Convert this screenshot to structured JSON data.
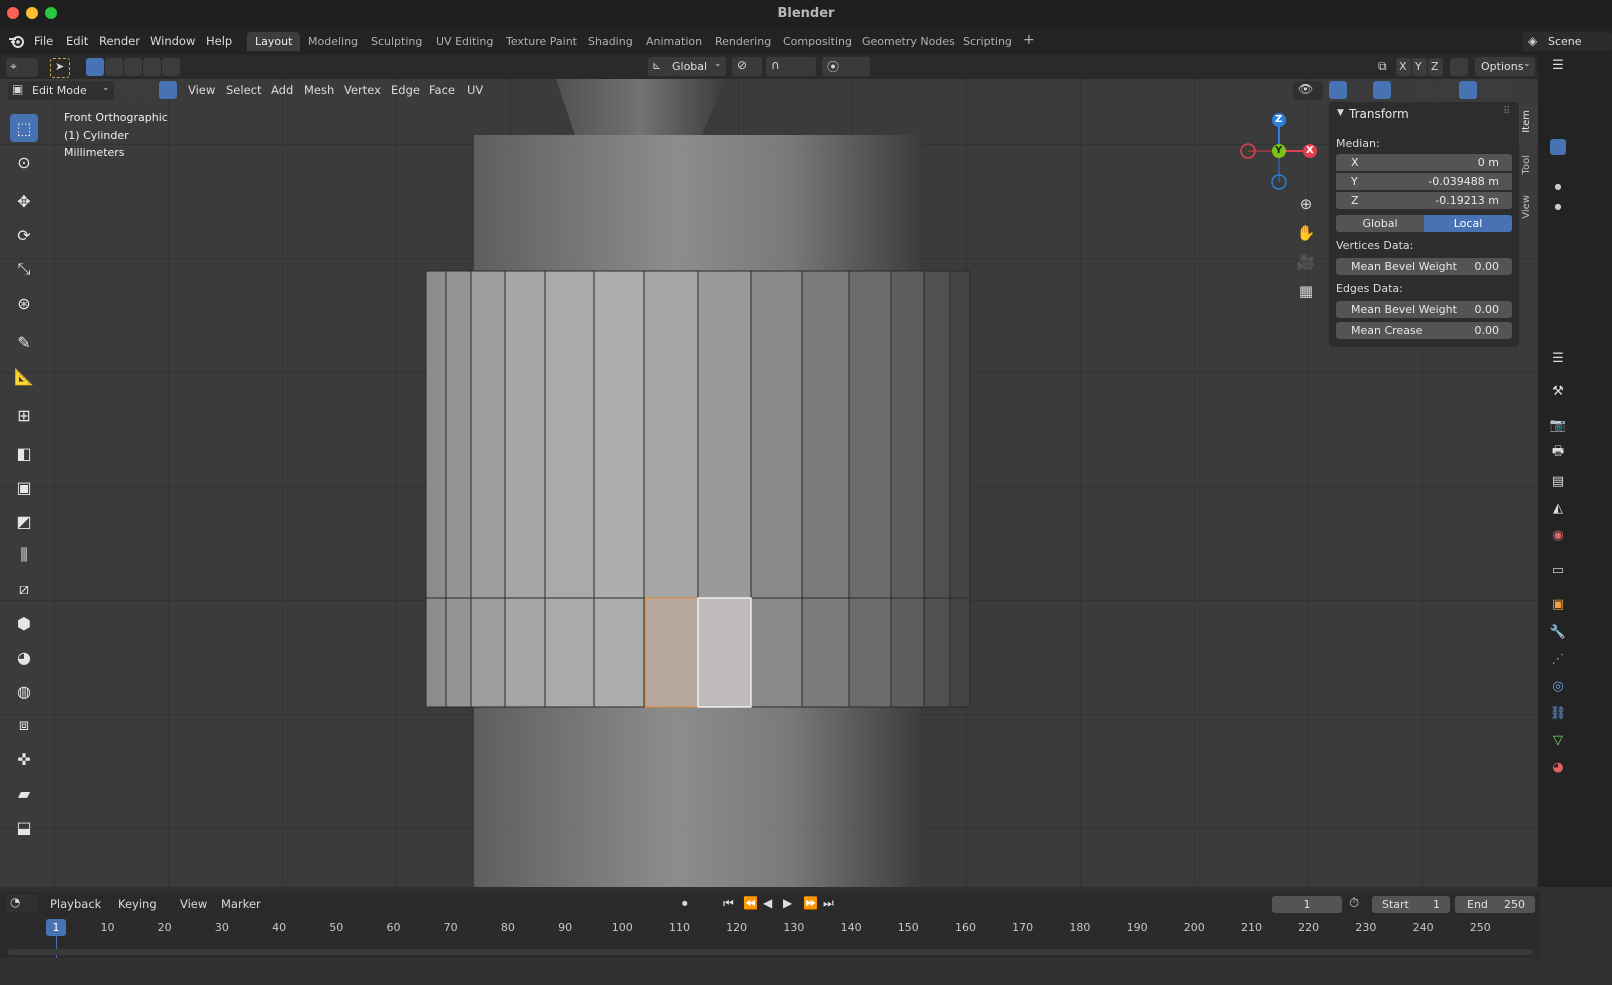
{
  "window": {
    "title": "Blender"
  },
  "menu": {
    "items": [
      "File",
      "Edit",
      "Render",
      "Window",
      "Help"
    ]
  },
  "workspaces": {
    "tabs": [
      "Layout",
      "Modeling",
      "Sculpting",
      "UV Editing",
      "Texture Paint",
      "Shading",
      "Animation",
      "Rendering",
      "Compositing",
      "Geometry Nodes",
      "Scripting"
    ],
    "active": "Layout",
    "add_symbol": "+"
  },
  "scene": {
    "label": "Scene"
  },
  "header": {
    "orientation": "Global",
    "axes": [
      "X",
      "Y",
      "Z"
    ],
    "options_label": "Options",
    "mode": "Edit Mode",
    "menus": [
      "View",
      "Select",
      "Add",
      "Mesh",
      "Vertex",
      "Edge",
      "Face",
      "UV"
    ]
  },
  "viewport": {
    "view_name": "Front Orthographic",
    "object_name": "(1) Cylinder",
    "units": "Millimeters",
    "gizmo": {
      "z": "Z",
      "y": "Y",
      "x": "X"
    }
  },
  "npanel": {
    "tabs": [
      "Item",
      "Tool",
      "View"
    ],
    "section": "Transform",
    "median_label": "Median:",
    "median": {
      "x_label": "X",
      "x": "0 m",
      "y_label": "Y",
      "y": "-0.039488 m",
      "z_label": "Z",
      "z": "-0.19213 m"
    },
    "space": {
      "global": "Global",
      "local": "Local",
      "active": "Local"
    },
    "vertices_data_label": "Vertices Data:",
    "vertex_bevel": {
      "label": "Mean Bevel Weight",
      "value": "0.00"
    },
    "edges_data_label": "Edges Data:",
    "edge_bevel": {
      "label": "Mean Bevel Weight",
      "value": "0.00"
    },
    "edge_crease": {
      "label": "Mean Crease",
      "value": "0.00"
    }
  },
  "timeline": {
    "menus": [
      "Playback",
      "Keying",
      "View",
      "Marker"
    ],
    "current_frame": "1",
    "start_label": "Start",
    "start": "1",
    "end_label": "End",
    "end": "250",
    "ruler": [
      "1",
      "10",
      "20",
      "30",
      "40",
      "50",
      "60",
      "70",
      "80",
      "90",
      "100",
      "110",
      "120",
      "130",
      "140",
      "150",
      "160",
      "170",
      "180",
      "190",
      "200",
      "210",
      "220",
      "230",
      "240",
      "250"
    ]
  },
  "colors": {
    "accent": "#4772b3",
    "selected_face": "#c4a898",
    "active_face": "#c9c2c4"
  }
}
